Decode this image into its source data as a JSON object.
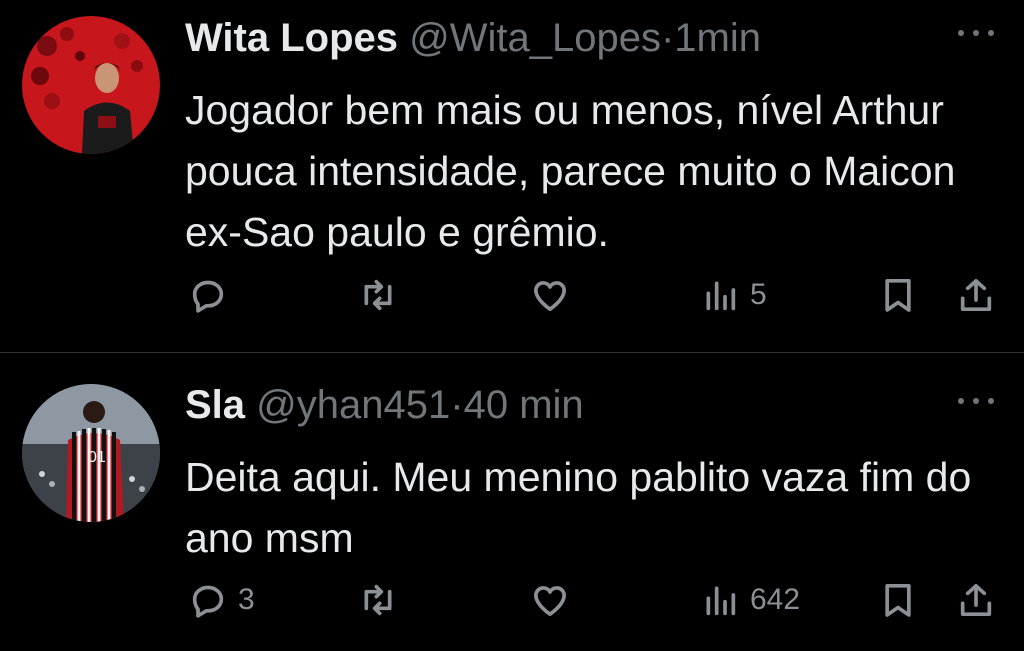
{
  "tweets": [
    {
      "name": "Wita Lopes",
      "handle": "@Wita_Lopes",
      "separator": "·",
      "time": "1min",
      "text": "Jogador bem mais ou menos, nível Arthur pouca intensidade, parece muito o Maicon ex-Sao paulo e grêmio.",
      "reply_count": "",
      "views": "5"
    },
    {
      "name": "Sla",
      "handle": "@yhan451",
      "separator": "·",
      "time": "40 min",
      "text": "Deita aqui. Meu menino pablito vaza fim do ano msm",
      "reply_count": "3",
      "views": "642"
    }
  ],
  "icons": [
    "reply-icon",
    "retweet-icon",
    "like-icon",
    "views-icon",
    "bookmark-icon",
    "share-icon",
    "more-icon"
  ],
  "colors": {
    "background": "#000000",
    "text": "#e7e9ea",
    "muted": "#71767b",
    "divider": "#2f3336"
  }
}
